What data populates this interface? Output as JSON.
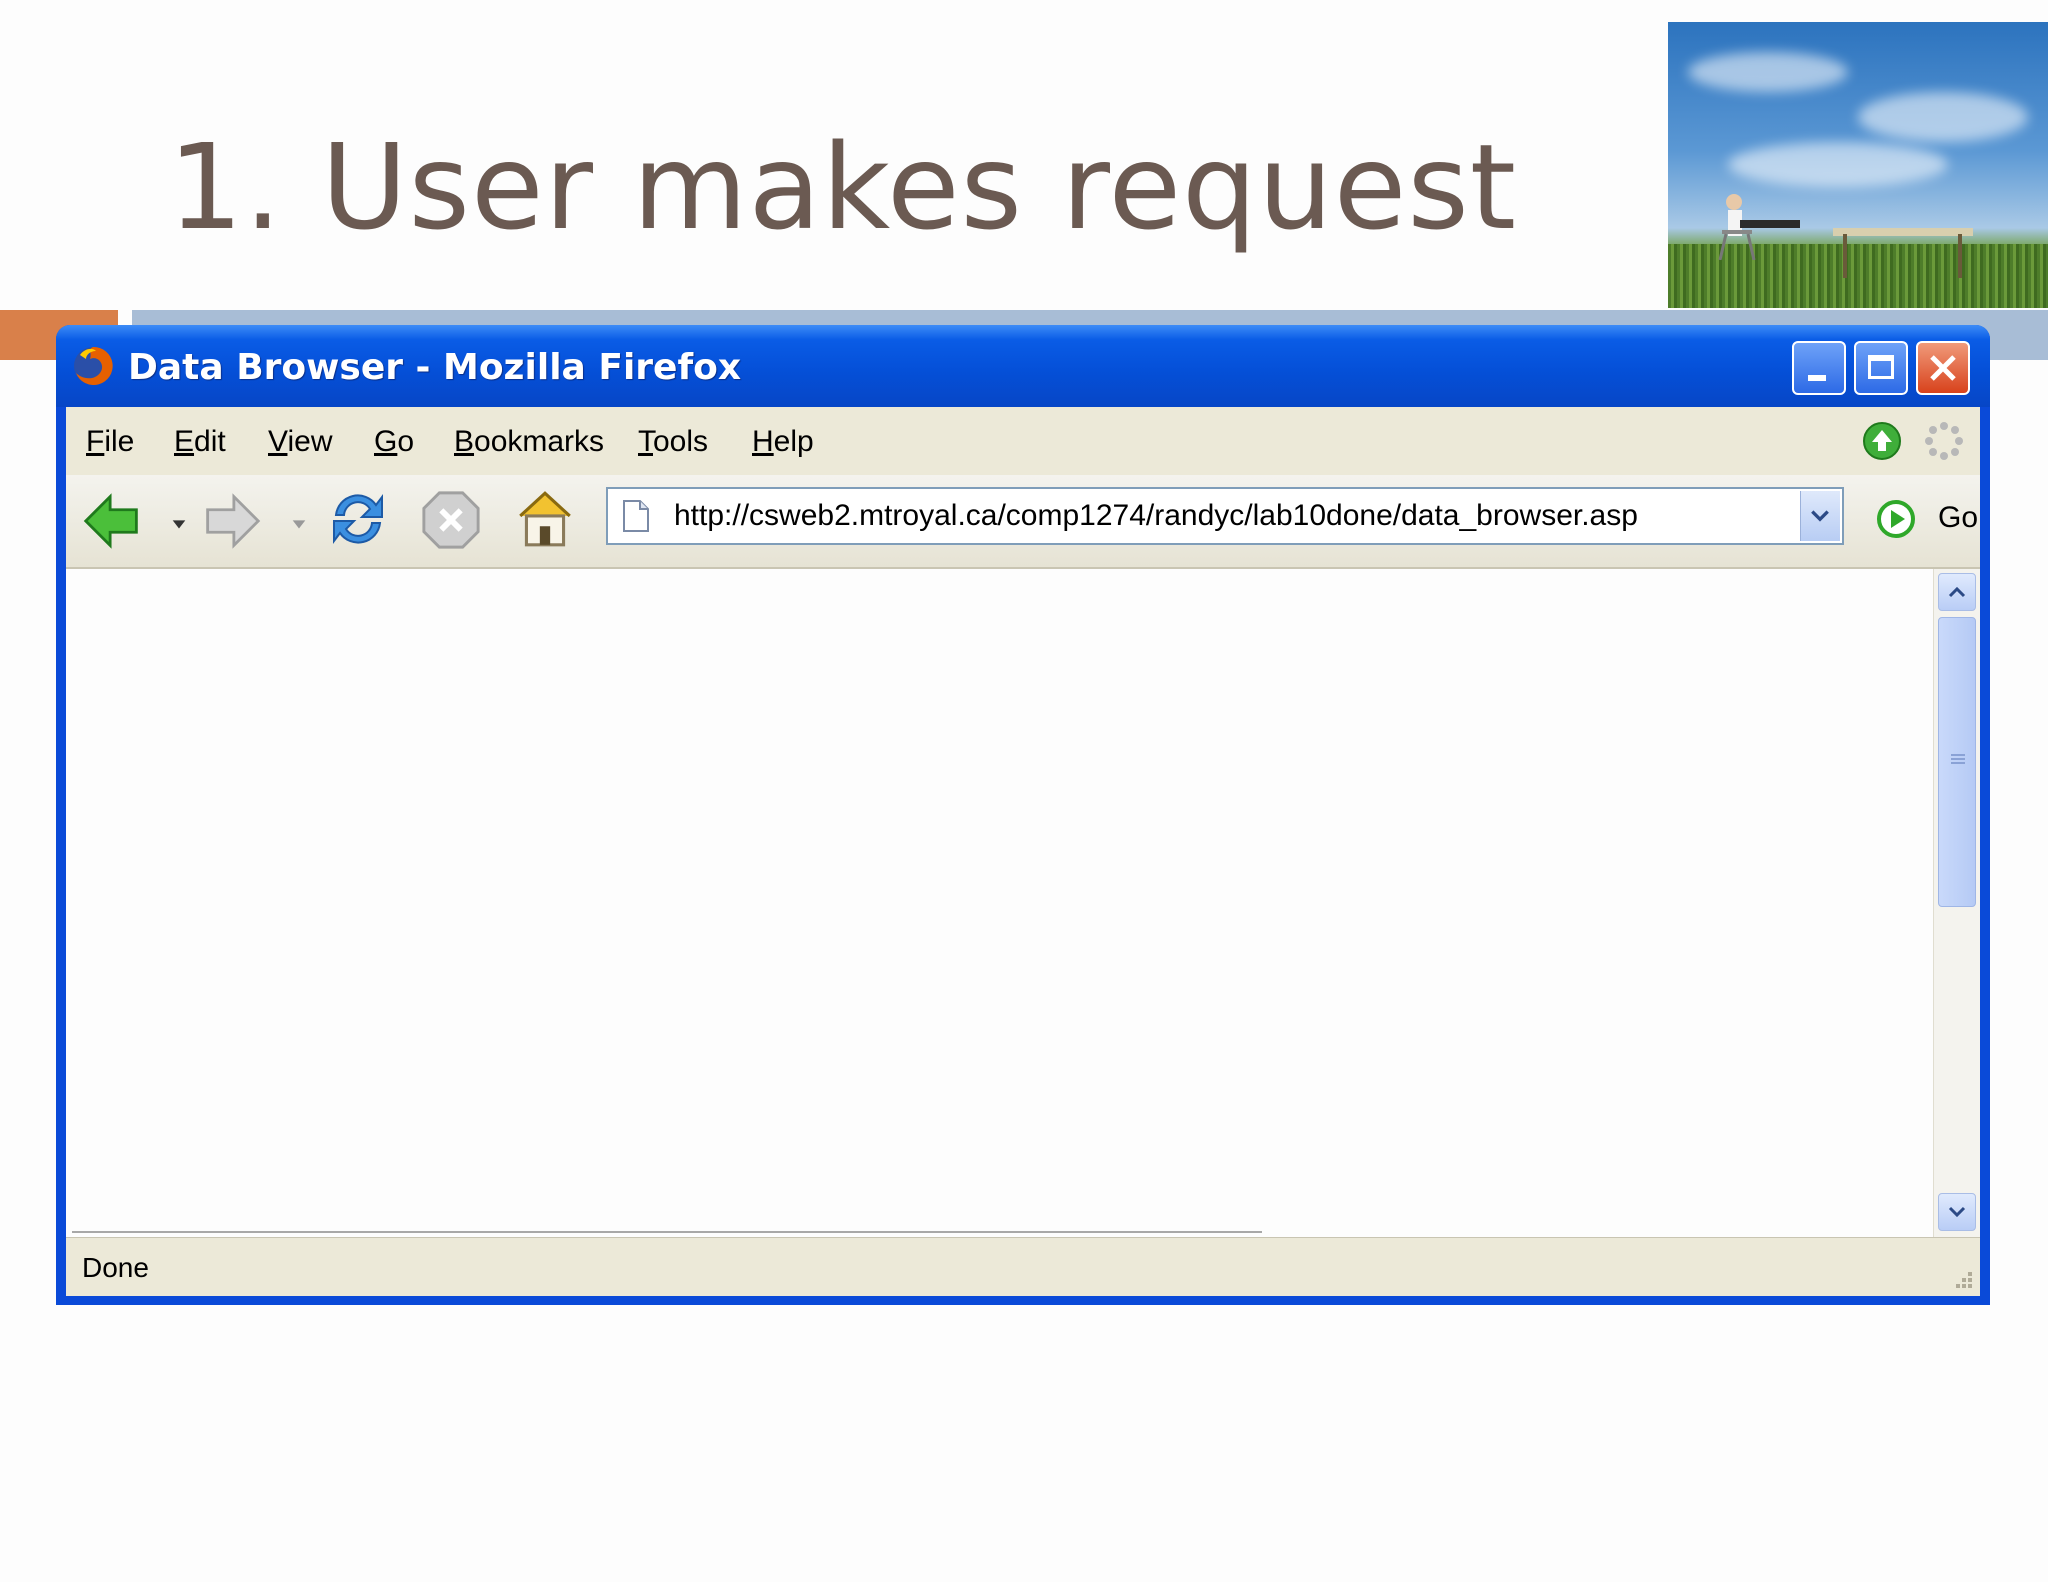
{
  "slide": {
    "title": "1. User makes request"
  },
  "browser": {
    "window_title": "Data Browser - Mozilla Firefox",
    "menu": [
      "File",
      "Edit",
      "View",
      "Go",
      "Bookmarks",
      "Tools",
      "Help"
    ],
    "toolbar": {
      "back_icon": "back-arrow-icon",
      "forward_icon": "forward-arrow-icon",
      "reload_icon": "reload-icon",
      "stop_icon": "stop-icon",
      "home_icon": "home-icon"
    },
    "url": "http://csweb2.mtroyal.ca/comp1274/randyc/lab10done/data_browser.asp",
    "go_label": "Go",
    "status": "Done"
  },
  "colors": {
    "title_text": "#6b5a52",
    "accent_orange": "#d9804a",
    "accent_blue": "#a8bdd6",
    "xp_titlebar": "#0550d8"
  }
}
